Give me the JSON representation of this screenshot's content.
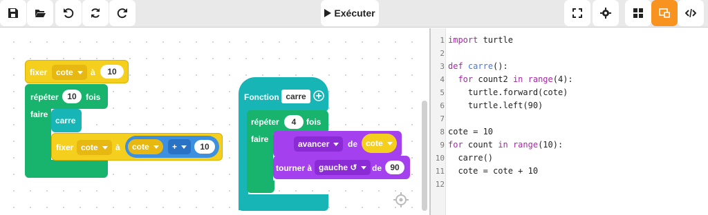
{
  "toolbar": {
    "run_label": "Exécuter",
    "left_buttons": [
      "save-icon",
      "open-folder-icon",
      "undo-icon",
      "redo-icon",
      "refresh-icon"
    ],
    "right_buttons": [
      "fullscreen-icon",
      "settings-icon",
      "blocks-view-icon",
      "split-view-icon",
      "code-view-icon"
    ],
    "active_button": "split-view-icon",
    "accent": "#f7931e"
  },
  "blocks": {
    "set_var": {
      "label": "fixer",
      "var": "cote",
      "to": "à",
      "value": "10"
    },
    "repeat": {
      "label": "répéter",
      "count": "10",
      "suffix": "fois",
      "do": "faire"
    },
    "call": {
      "label": "carre"
    },
    "set_var2": {
      "label": "fixer",
      "var": "cote",
      "to": "à",
      "expr_var": "cote",
      "op": "+",
      "value": "10"
    },
    "function": {
      "label": "Fonction",
      "name": "carre"
    },
    "repeat2": {
      "label": "répéter",
      "count": "4",
      "suffix": "fois",
      "do": "faire"
    },
    "forward": {
      "label": "avancer",
      "de": "de",
      "var": "cote"
    },
    "turn": {
      "label": "tourner à",
      "dir": "gauche ↺",
      "de": "de",
      "value": "90"
    }
  },
  "code": {
    "lines": [
      {
        "n": "1",
        "text": "import turtle"
      },
      {
        "n": "2",
        "text": ""
      },
      {
        "n": "3",
        "text": "def carre():"
      },
      {
        "n": "4",
        "text": "  for count2 in range(4):"
      },
      {
        "n": "5",
        "text": "    turtle.forward(cote)"
      },
      {
        "n": "6",
        "text": "    turtle.left(90)"
      },
      {
        "n": "7",
        "text": ""
      },
      {
        "n": "8",
        "text": "cote = 10"
      },
      {
        "n": "9",
        "text": "for count in range(10):"
      },
      {
        "n": "10",
        "text": "  carre()"
      },
      {
        "n": "11",
        "text": "  cote = cote + 10"
      },
      {
        "n": "12",
        "text": ""
      }
    ]
  }
}
